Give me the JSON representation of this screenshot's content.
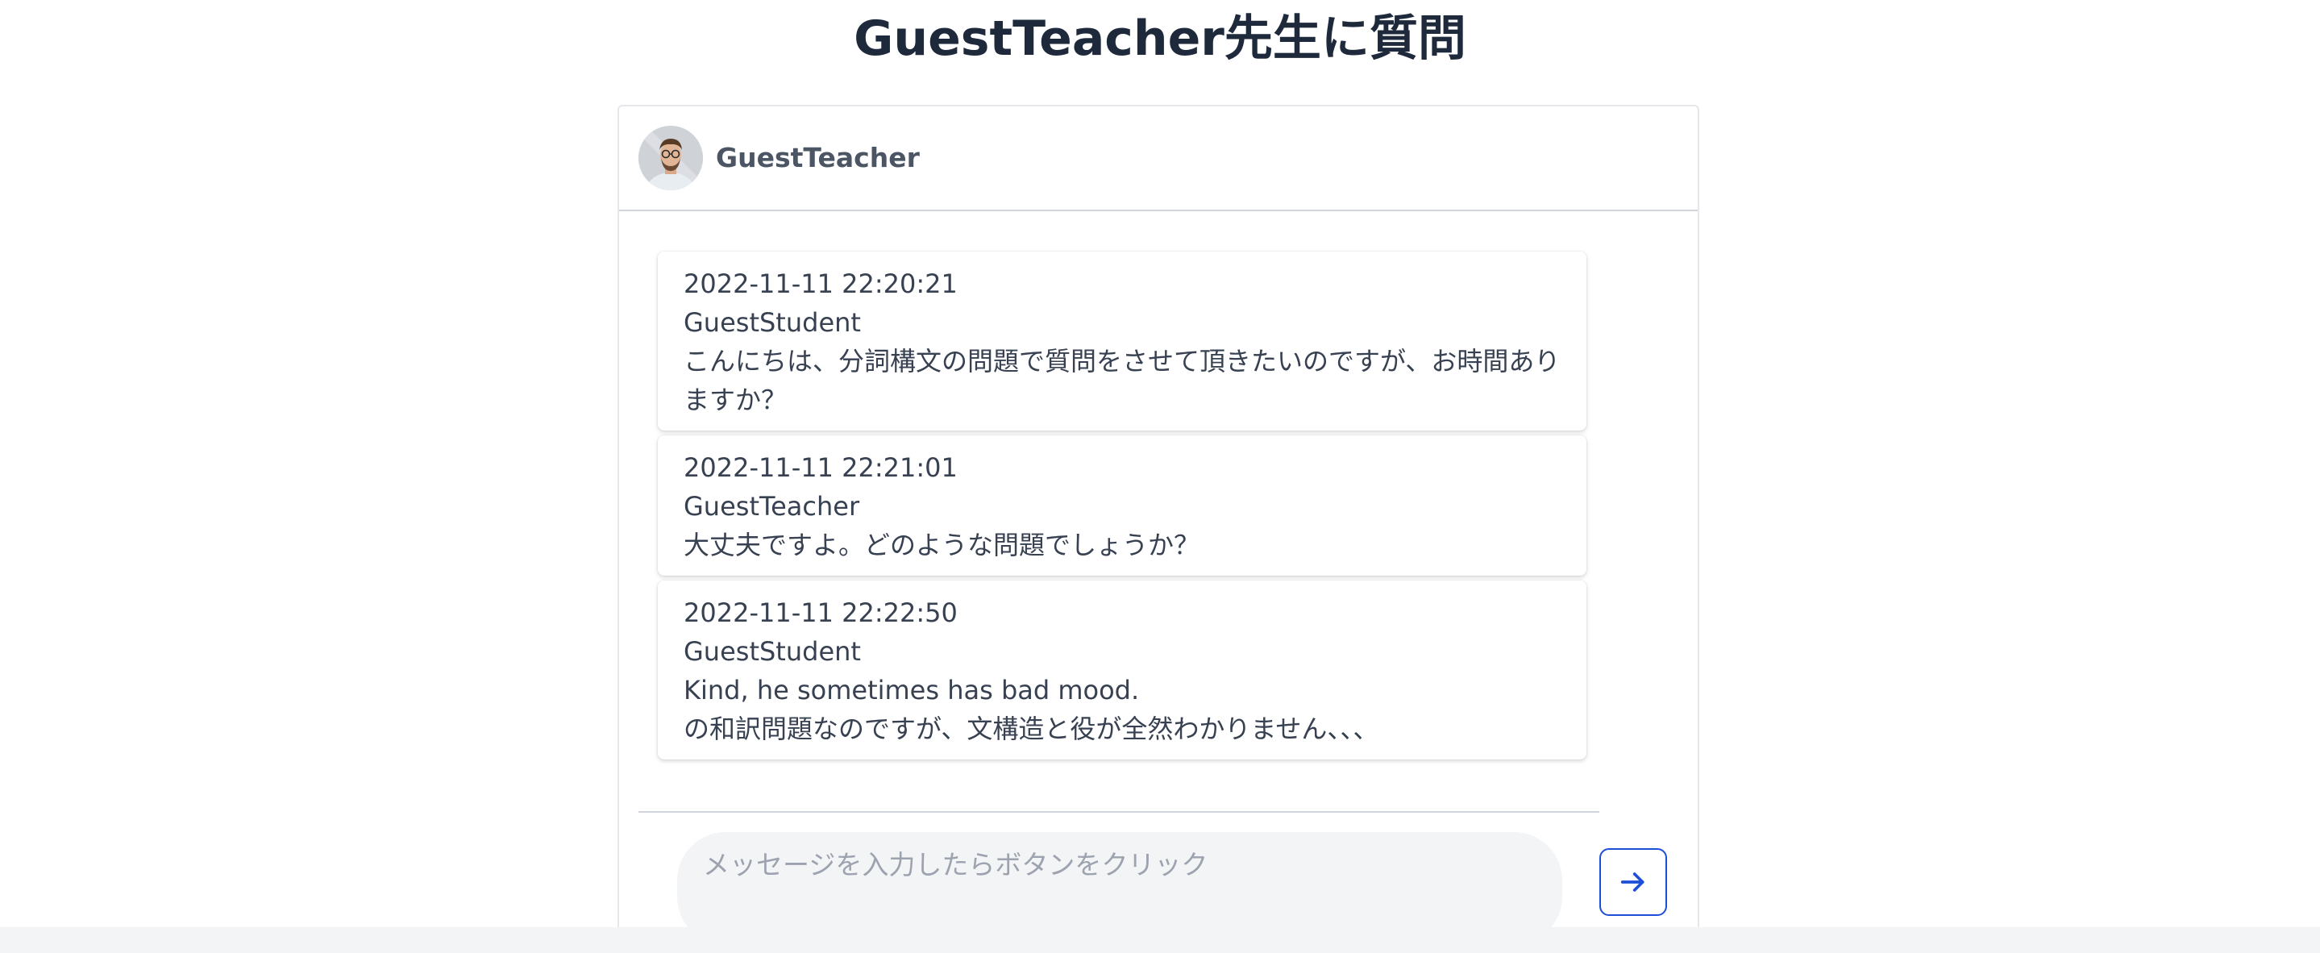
{
  "page": {
    "title": "GuestTeacher先生に質問"
  },
  "header": {
    "teacher_name": "GuestTeacher",
    "avatar_icon": "person-avatar-icon"
  },
  "messages": [
    {
      "timestamp": "2022-11-11 22:20:21",
      "sender": "GuestStudent",
      "lines": [
        "こんにちは、分詞構文の問題で質問をさせて頂きたいのですが、お時間ありますか？"
      ]
    },
    {
      "timestamp": "2022-11-11 22:21:01",
      "sender": "GuestTeacher",
      "lines": [
        "大丈夫ですよ。どのような問題でしょうか？"
      ]
    },
    {
      "timestamp": "2022-11-11 22:22:50",
      "sender": "GuestStudent",
      "lines": [
        "Kind, he sometimes has bad mood.",
        "の和訳問題なのですが、文構造と役が全然わかりません、、、"
      ]
    }
  ],
  "composer": {
    "placeholder": "メッセージを入力したらボタンをクリック",
    "value": "",
    "send_icon": "arrow-right-icon"
  },
  "colors": {
    "accent": "#1d4ed8",
    "title": "#1e293b",
    "input_bg": "#f3f4f6"
  }
}
